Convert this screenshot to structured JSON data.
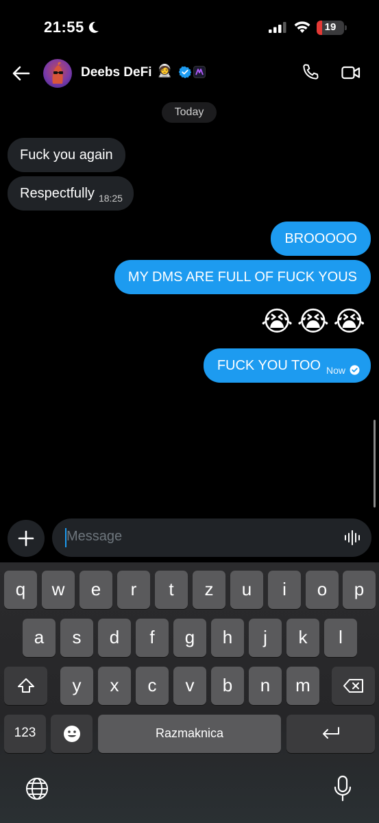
{
  "status_bar": {
    "time": "21:55",
    "battery": "19"
  },
  "header": {
    "contact_name": "Deebs DeFi",
    "name_emoji": "🧑‍🚀"
  },
  "chat": {
    "date_label": "Today",
    "incoming": [
      {
        "text": "Fuck you again"
      },
      {
        "text": "Respectfully",
        "time": "18:25"
      }
    ],
    "outgoing": [
      {
        "text": "BROOOOO"
      },
      {
        "text": "MY DMS ARE FULL OF FUCK YOUS"
      },
      {
        "text": "😭😭😭"
      },
      {
        "text": "FUCK YOU TOO",
        "time": "Now"
      }
    ]
  },
  "composer": {
    "placeholder": "Message"
  },
  "keyboard": {
    "row1": [
      "q",
      "w",
      "e",
      "r",
      "t",
      "z",
      "u",
      "i",
      "o",
      "p"
    ],
    "row2": [
      "a",
      "s",
      "d",
      "f",
      "g",
      "h",
      "j",
      "k",
      "l"
    ],
    "row3": [
      "y",
      "x",
      "c",
      "v",
      "b",
      "n",
      "m"
    ],
    "numbers_label": "123",
    "space_label": "Razmaknica"
  },
  "colors": {
    "accent": "#1d9bf0",
    "incoming_bubble": "#202327",
    "background": "#000000"
  },
  "icons": [
    "back-arrow",
    "phone",
    "video-camera",
    "plus",
    "voice-wave",
    "shift",
    "backspace",
    "emoji",
    "return",
    "globe",
    "microphone",
    "verified-badge"
  ]
}
